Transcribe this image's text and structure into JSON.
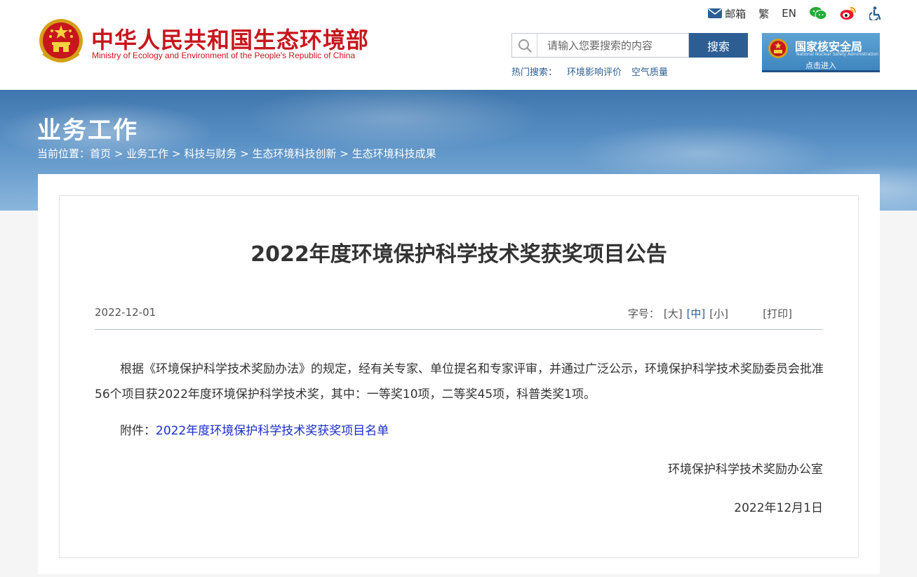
{
  "header": {
    "title": "中华人民共和国生态环境部",
    "subtitle": "Ministry of Ecology and Environment of the People's Republic of China",
    "toplinks": {
      "mail": "邮箱",
      "traditional": "繁",
      "english": "EN"
    },
    "search": {
      "placeholder": "请输入您要搜索的内容",
      "value": "",
      "button": "搜索"
    },
    "hot": {
      "label": "热门搜索：",
      "items": [
        "环境影响评价",
        "空气质量"
      ]
    },
    "nnsa": {
      "name": "国家核安全局",
      "name_en": "National Nuclear Safety Administration",
      "enter": "点击进入"
    }
  },
  "banner": {
    "title": "业务工作",
    "breadcrumb": {
      "label": "当前位置：",
      "sep": ">",
      "items": [
        "首页",
        "业务工作",
        "科技与财务",
        "生态环境科技创新",
        "生态环境科技成果"
      ]
    }
  },
  "article": {
    "title": "2022年度环境保护科学技术奖获奖项目公告",
    "date": "2022-12-01",
    "font_size": {
      "label": "字号：",
      "options": [
        "[大]",
        "[中]",
        "[小]"
      ],
      "selected": "[中]"
    },
    "print": "[打印]",
    "body": "根据《环境保护科学技术奖励办法》的规定，经有关专家、单位提名和专家评审，并通过广泛公示，环境保护科学技术奖励委员会批准56个项目获2022年度环境保护科学技术奖，其中：一等奖10项，二等奖45项，科普类奖1项。",
    "attachment": {
      "label": "附件：",
      "link": "2022年度环境保护科学技术奖获奖项目名单"
    },
    "signature": "环境保护科学技术奖励办公室",
    "signature_date": "2022年12月1日"
  },
  "colors": {
    "brand_red": "#c8161d",
    "brand_blue": "#2c5e93",
    "link_blue": "#1a2fc9"
  }
}
